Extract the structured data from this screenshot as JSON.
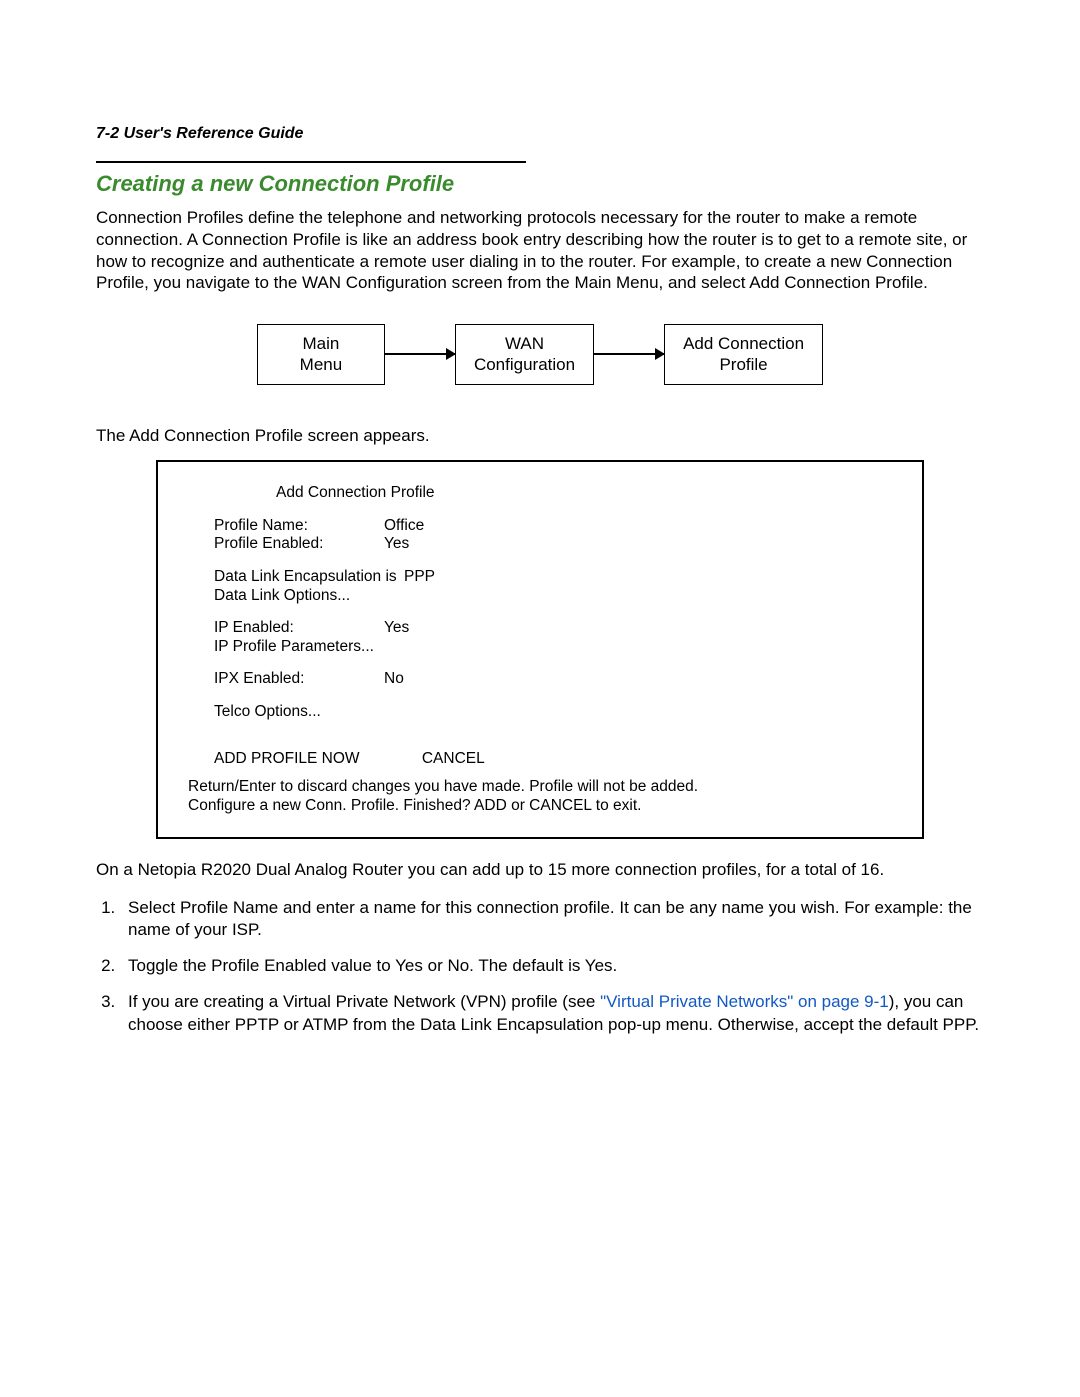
{
  "header": {
    "pageLabel": "7-2  User's Reference Guide"
  },
  "section": {
    "title": "Creating a new Connection Profile",
    "intro": "Connection Profiles define the telephone and networking protocols necessary for the router to make a remote connection. A Connection Profile is like an address book entry describing how the router is to get to a remote site, or how to recognize and authenticate a remote user dialing in to the router. For example, to create a new Connection Profile, you navigate to the WAN Configuration screen from the Main Menu, and select Add Connection Profile."
  },
  "flow": {
    "box1_line1": "Main",
    "box1_line2": "Menu",
    "box2_line1": "WAN",
    "box2_line2": "Configuration",
    "box3_line1": "Add Connection",
    "box3_line2": "Profile"
  },
  "caption1": "The Add Connection Profile screen appears.",
  "screen": {
    "title": "Add Connection Profile",
    "profileName_label": "Profile Name:",
    "profileName_value": "Office",
    "profileEnabled_label": "Profile Enabled:",
    "profileEnabled_value": "Yes",
    "dle_label": "Data Link Encapsulation is",
    "dle_value": "PPP",
    "dlo_label": "Data Link Options...",
    "ipEnabled_label": "IP Enabled:",
    "ipEnabled_value": "Yes",
    "ipParams_label": "IP Profile Parameters...",
    "ipxEnabled_label": "IPX Enabled:",
    "ipxEnabled_value": "No",
    "telco_label": "Telco Options...",
    "addNow": "ADD PROFILE NOW",
    "cancel": "CANCEL",
    "footer1": "Return/Enter to discard changes you have made. Profile will not be added.",
    "footer2": "Configure a new Conn. Profile. Finished?  ADD or CANCEL to exit."
  },
  "afterScreen": "On a Netopia R2020 Dual Analog Router you can add up to 15 more connection profiles, for a total of 16.",
  "steps": {
    "s1": "Select Profile Name and enter a name for this connection profile. It can be any name you wish. For example: the name of your ISP.",
    "s2": "Toggle the Profile Enabled value to Yes or No. The default is Yes.",
    "s3a": "If you are creating a Virtual Private Network (VPN) profile (see ",
    "s3link": "\"Virtual Private Networks\" on page 9-1",
    "s3b": "), you can choose either PPTP or ATMP from the Data Link Encapsulation pop-up menu. Otherwise, accept the default PPP."
  }
}
